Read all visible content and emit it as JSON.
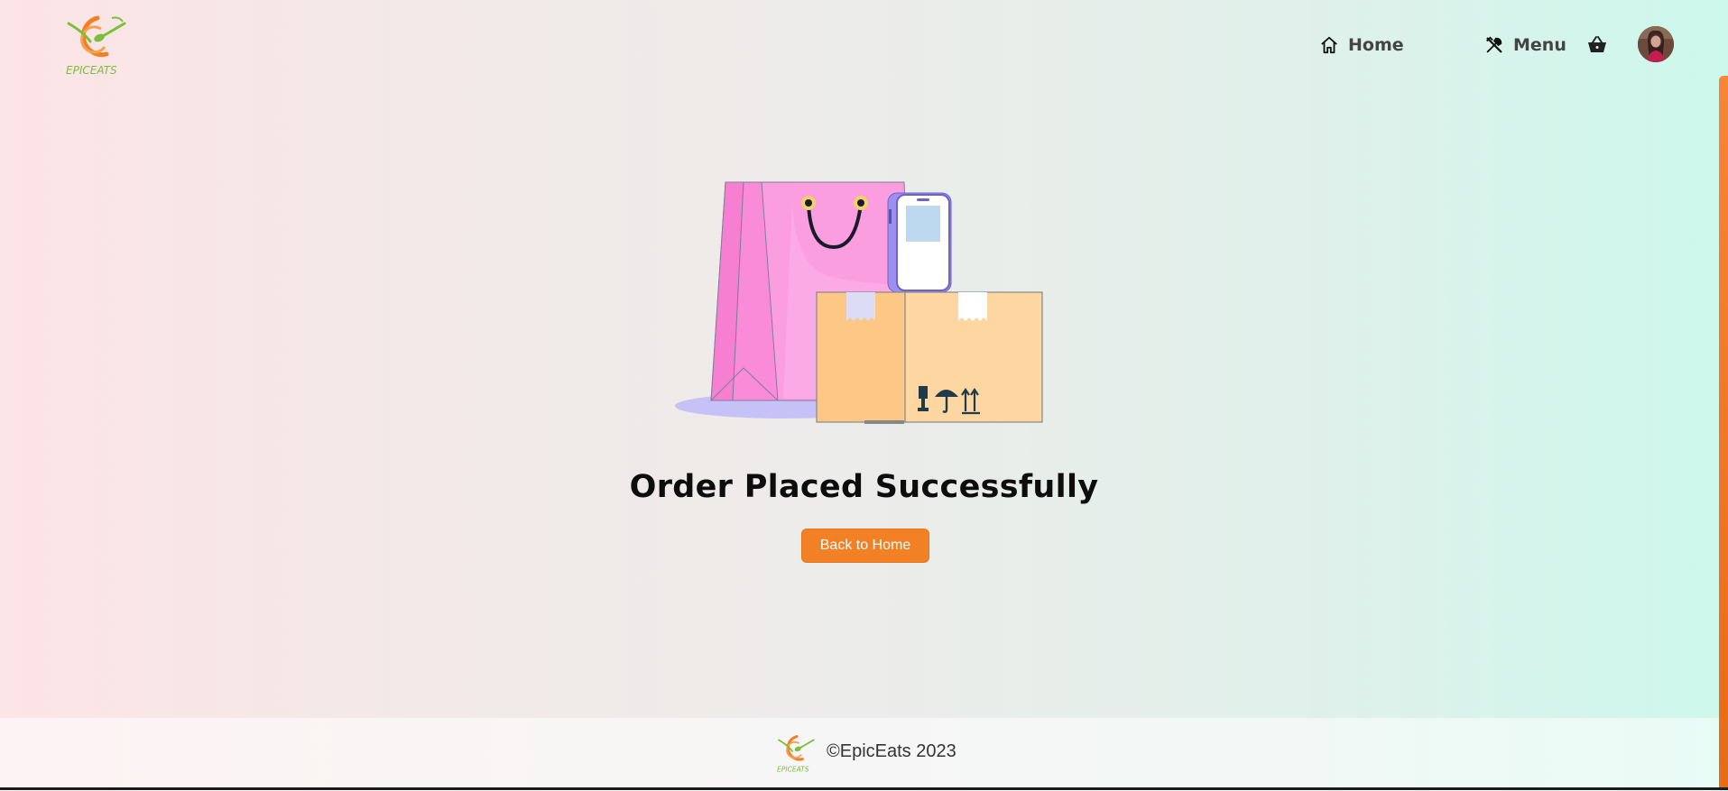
{
  "brand": {
    "name": "EPICEATS",
    "accent": "#f28024",
    "logo_green": "#7bbf3a"
  },
  "nav": {
    "home_label": "Home",
    "menu_label": "Menu",
    "home_icon": "home-icon",
    "menu_icon": "utensils-icon",
    "cart_icon": "basket-icon"
  },
  "main": {
    "title": "Order Placed Successfully",
    "back_button_label": "Back to Home"
  },
  "footer": {
    "copyright": "©EpicEats 2023"
  }
}
